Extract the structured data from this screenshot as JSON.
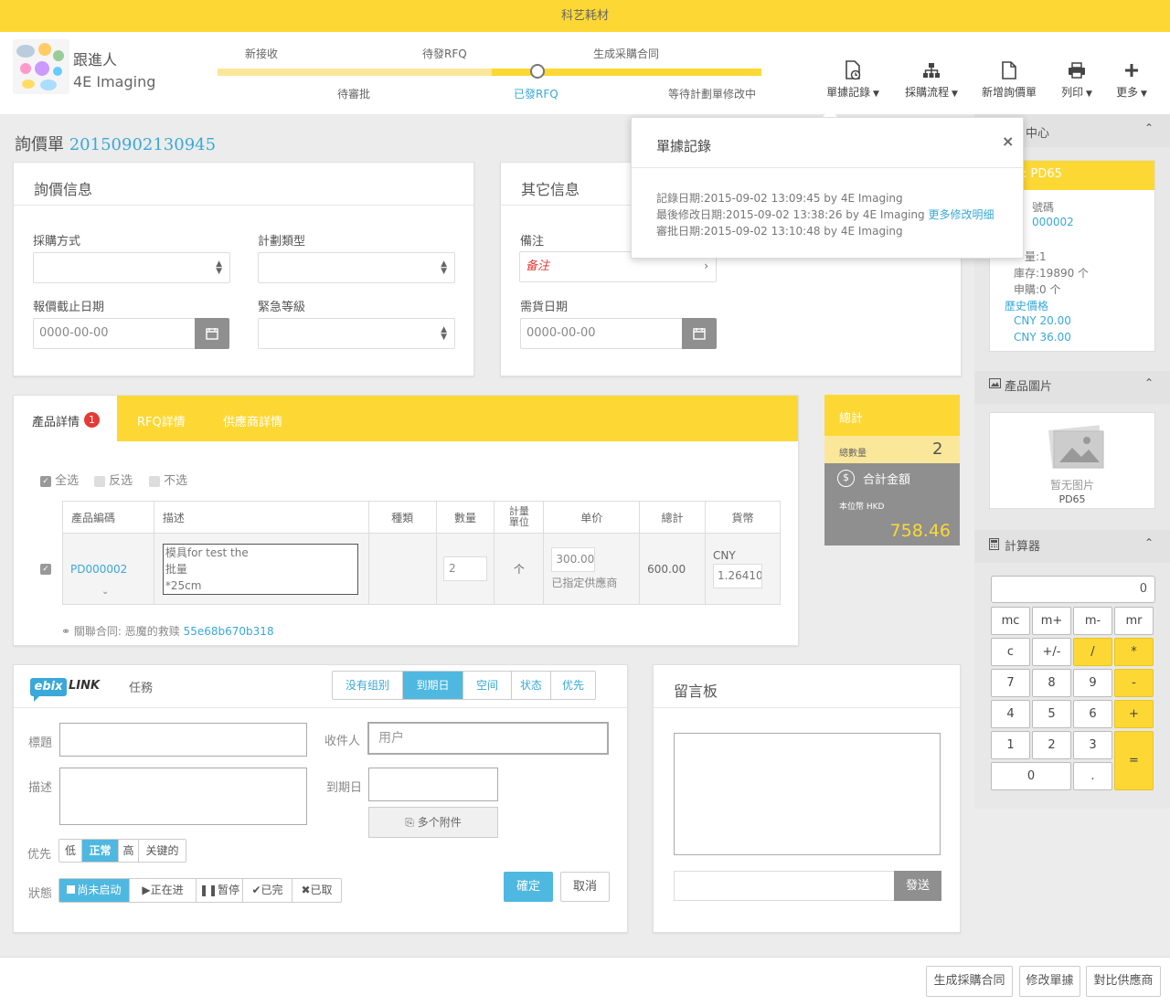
{
  "topbar": {
    "title": "科艺耗材"
  },
  "header": {
    "follower_label": "跟進人",
    "company": "4E Imaging",
    "steps_top": [
      "新接收",
      "待發RFQ",
      "生成采購合同"
    ],
    "steps_bottom": [
      "待審批",
      "已發RFQ",
      "等待計劃單修改中"
    ],
    "toolbar": [
      {
        "label": "單據記錄",
        "icon": "document-clock-icon",
        "caret": true
      },
      {
        "label": "採購流程",
        "icon": "flow-chart-icon",
        "caret": true
      },
      {
        "label": "新增詢價單",
        "icon": "new-document-icon",
        "caret": false
      },
      {
        "label": "列印",
        "icon": "printer-icon",
        "caret": true
      },
      {
        "label": "更多",
        "icon": "plus-icon",
        "caret": true
      }
    ]
  },
  "page": {
    "title": "詢價單",
    "number": "20150902130945"
  },
  "inquiry": {
    "heading": "詢價信息",
    "method_label": "採購方式",
    "plan_type_label": "計劃類型",
    "deadline_label": "報價截止日期",
    "deadline_placeholder": "0000-00-00",
    "urgency_label": "緊急等級"
  },
  "other": {
    "heading": "其它信息",
    "remark_label": "備注",
    "remark_value": "备注",
    "required_date_label": "需貨日期",
    "required_date_placeholder": "0000-00-00"
  },
  "popover": {
    "title": "單據記錄",
    "close": "×",
    "record_line": "記錄日期:2015-09-02 13:09:45   by   4E Imaging",
    "modified_line": "最後修改日期:2015-09-02 13:38:26   by   4E Imaging",
    "more_link": "更多修改明细",
    "approve_line": "審批日期:2015-09-02 13:10:48   by   4E Imaging"
  },
  "product": {
    "tabs": [
      "產品詳情",
      "RFQ詳情",
      "供應商詳情"
    ],
    "badge": "1",
    "select_all": "全选",
    "invert": "反选",
    "select_none": "不选",
    "columns": [
      "產品編碼",
      "描述",
      "種類",
      "數量",
      "計量單位",
      "单价",
      "總計",
      "貨幣"
    ],
    "row": {
      "code": "PD000002",
      "desc": "模具for test the\n批量\n*25cm",
      "type": "",
      "qty": "2",
      "unit": "个",
      "price": "300.00",
      "supplier_note": "已指定供應商",
      "total": "600.00",
      "currency": "CNY",
      "rate": "1.26410"
    },
    "contract_label": "關聯合同:",
    "contract_name": "恶魔的救赎",
    "contract_id": "55e68b670b318"
  },
  "summary": {
    "title": "總計",
    "qty_label": "總數量",
    "qty": "2",
    "amount_label": "合計金額",
    "currency_label": "本位幣 HKD",
    "amount": "758.46"
  },
  "task": {
    "brand": "ebixLink",
    "title": "任務",
    "filters": [
      "没有组别",
      "到期日",
      "空间",
      "状态",
      "优先"
    ],
    "title_label": "標題",
    "desc_label": "描述",
    "recipient_label": "收件人",
    "recipient_placeholder": "用户",
    "due_label": "到期日",
    "attach": "多个附件",
    "priority_label": "优先",
    "priorities": [
      "低",
      "正常",
      "高",
      "关键的"
    ],
    "status_label": "狀態",
    "statuses": [
      "尚未启动",
      "正在进",
      "暂停",
      "已完",
      "已取"
    ],
    "confirm": "確定",
    "cancel": "取消"
  },
  "board": {
    "title": "留言板",
    "send": "發送"
  },
  "sidebar": {
    "center_title": "中心",
    "product_code": ": PD65",
    "code_label": "號碼",
    "code_value": "000002",
    "qty_line": "量:1",
    "stock_line": "庫存:19890 个",
    "order_line": "申購:0 个",
    "history_label": "歷史價格",
    "history": [
      "CNY 20.00",
      "CNY 36.00"
    ],
    "image_title": "產品圖片",
    "no_image": "暂无图片",
    "image_code": "PD65",
    "calc_title": "計算器",
    "calc_display": "0",
    "keys": [
      "mc",
      "m+",
      "m-",
      "mr",
      "c",
      "+/-",
      "/",
      "*",
      "7",
      "8",
      "9",
      "-",
      "4",
      "5",
      "6",
      "+",
      "1",
      "2",
      "3",
      "=",
      "0",
      "."
    ]
  },
  "footer": {
    "buttons": [
      "生成採購合同",
      "修改單據",
      "對比供應商"
    ]
  },
  "colors": {
    "yellow": "#fdd835",
    "link": "#3aa8d8",
    "blue": "#4fb8e0",
    "gray": "#8f8f8f",
    "red": "#e53935"
  }
}
